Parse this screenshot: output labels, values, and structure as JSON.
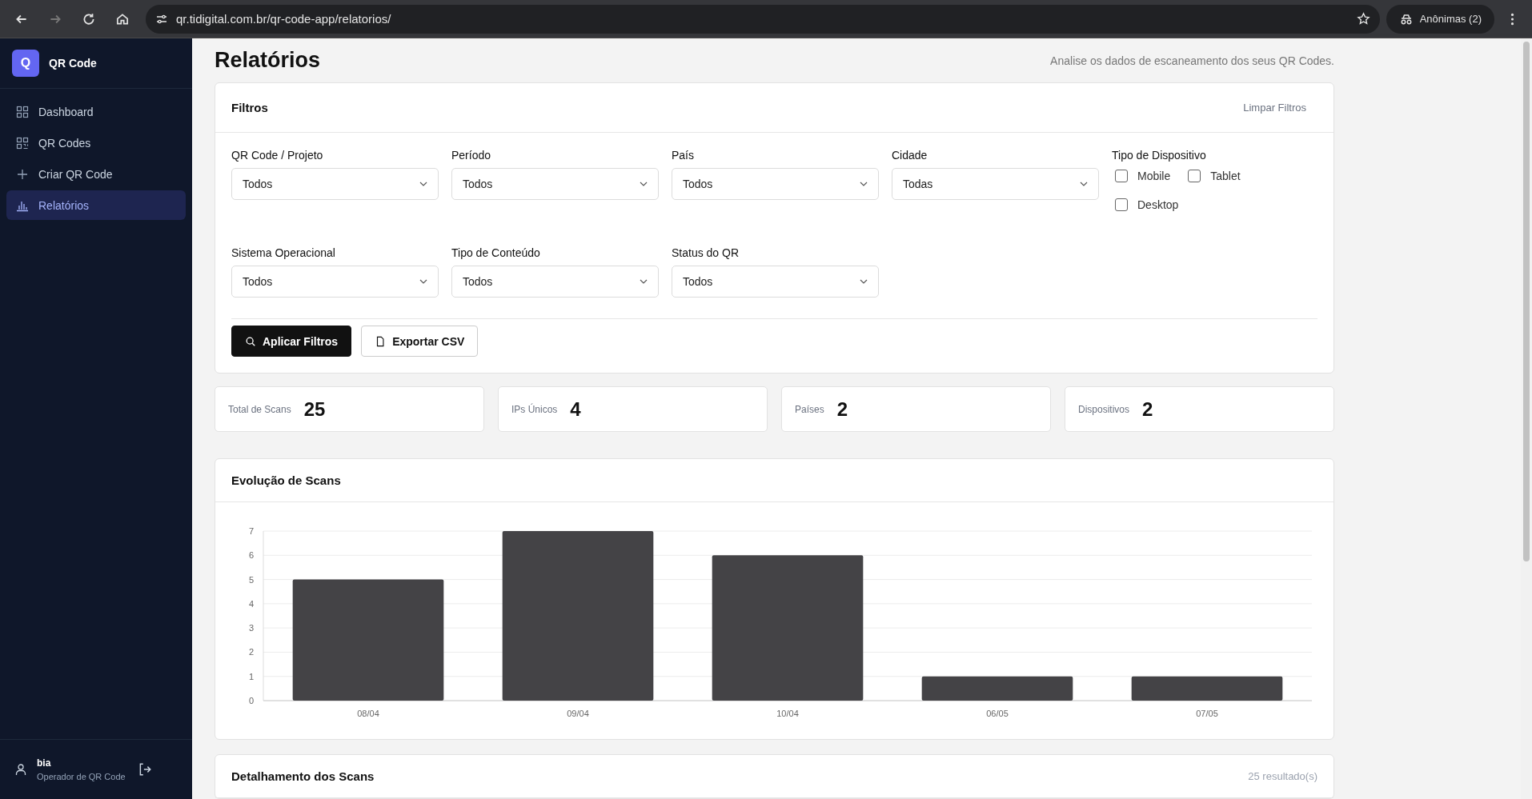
{
  "browser": {
    "url": "qr.tidigital.com.br/qr-code-app/relatorios/",
    "profile": "Anônimas (2)"
  },
  "sidebar": {
    "logo_letter": "Q",
    "app_name": "QR Code",
    "items": [
      {
        "label": "Dashboard",
        "selected": false
      },
      {
        "label": "QR Codes",
        "selected": false
      },
      {
        "label": "Criar QR Code",
        "selected": false
      },
      {
        "label": "Relatórios",
        "selected": true
      }
    ],
    "user": {
      "name": "bia",
      "role": "Operador de QR Code"
    }
  },
  "header": {
    "title": "Relatórios",
    "subtitle": "Analise os dados de escaneamento dos seus QR Codes."
  },
  "filters": {
    "title": "Filtros",
    "clear": "Limpar Filtros",
    "selects": [
      {
        "label": "QR Code / Projeto",
        "value": "Todos"
      },
      {
        "label": "Período",
        "value": "Todos"
      },
      {
        "label": "País",
        "value": "Todos"
      },
      {
        "label": "Cidade",
        "value": "Todas"
      },
      {
        "label": "Sistema Operacional",
        "value": "Todos"
      },
      {
        "label": "Tipo de Conteúdo",
        "value": "Todos"
      },
      {
        "label": "Status do QR",
        "value": "Todos"
      }
    ],
    "device_type": {
      "label": "Tipo de Dispositivo",
      "options": [
        {
          "label": "Mobile",
          "checked": false
        },
        {
          "label": "Tablet",
          "checked": false
        },
        {
          "label": "Desktop",
          "checked": false
        }
      ]
    },
    "buttons": [
      {
        "label": "Aplicar Filtros",
        "kind": "primary"
      },
      {
        "label": "Exportar CSV",
        "kind": "secondary"
      }
    ]
  },
  "stats": [
    {
      "label": "Total de Scans",
      "value": "25"
    },
    {
      "label": "IPs Únicos",
      "value": "4"
    },
    {
      "label": "Países",
      "value": "2"
    },
    {
      "label": "Dispositivos",
      "value": "2"
    }
  ],
  "chart": {
    "title": "Evolução de Scans",
    "chart_data": {
      "type": "bar",
      "categories": [
        "08/04",
        "09/04",
        "10/04",
        "06/05",
        "07/05"
      ],
      "series": [
        {
          "color": "#444346",
          "values": [
            5,
            7,
            6,
            1,
            1
          ]
        }
      ],
      "grid": true,
      "ylim": [
        0,
        7
      ],
      "yticks": [
        0,
        1,
        2,
        3,
        4,
        5,
        6,
        7
      ]
    }
  },
  "details": {
    "title": "Detalhamento dos Scans",
    "count": "25 resultado(s)"
  }
}
